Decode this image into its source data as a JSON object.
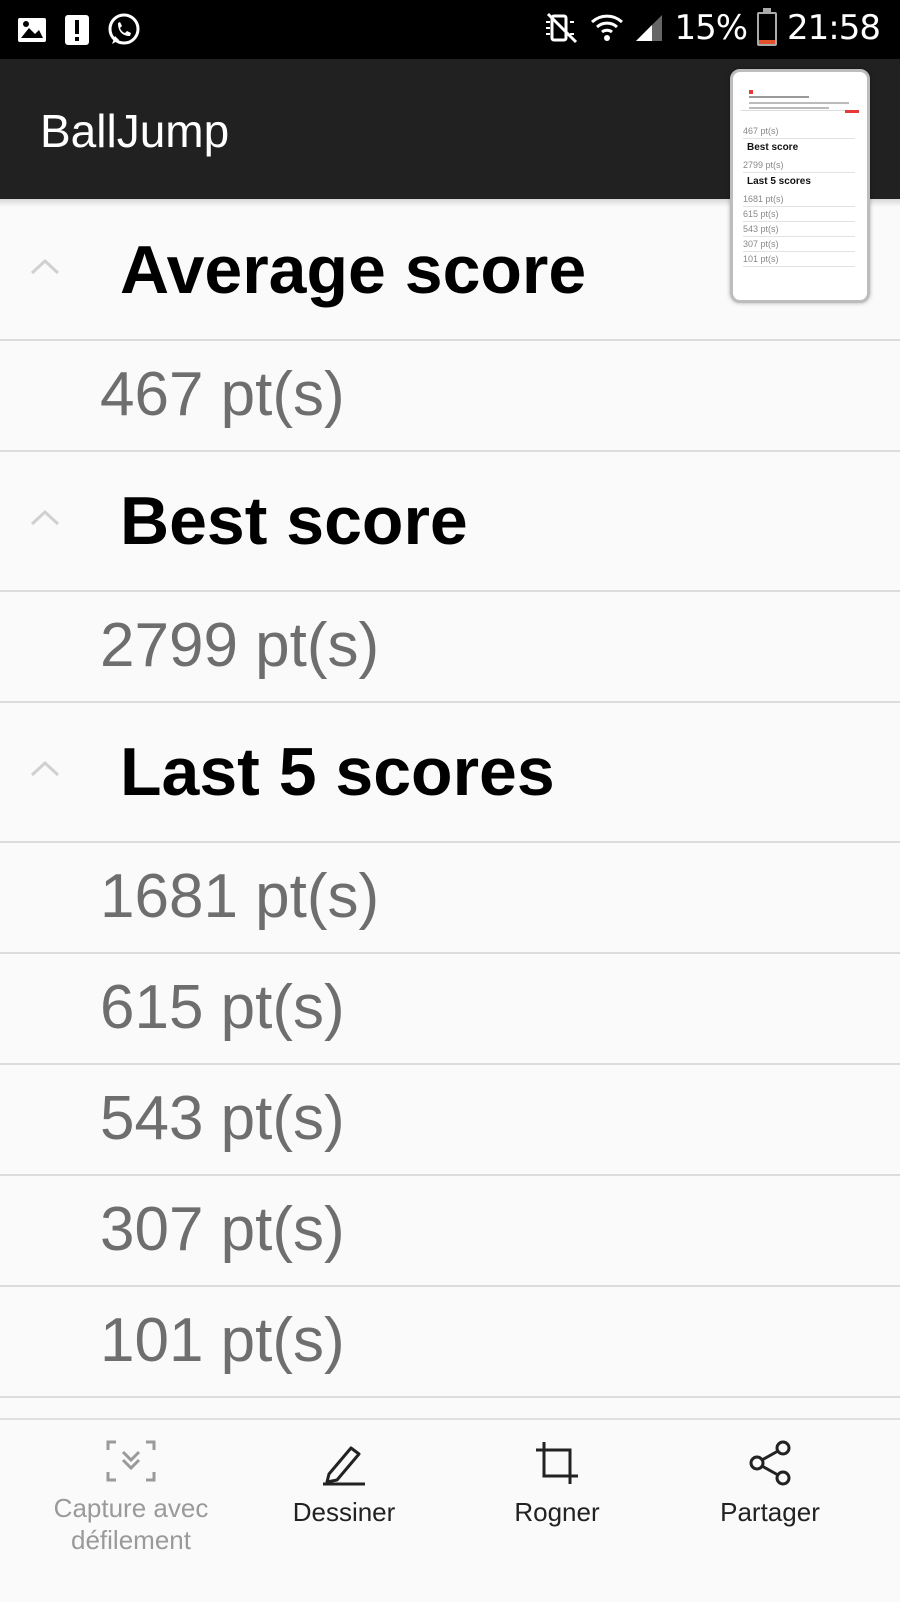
{
  "status_bar": {
    "battery": "15%",
    "time": "21:58",
    "battery_level": 0.15,
    "icons": [
      "gallery-icon",
      "alert-icon",
      "whatsapp-icon",
      "mute-icon",
      "wifi-icon",
      "signal-icon",
      "battery-icon"
    ]
  },
  "app_bar": {
    "title": "BallJump"
  },
  "sections": [
    {
      "title": "Average score",
      "scores": [
        "467 pt(s)"
      ]
    },
    {
      "title": "Best score",
      "scores": [
        "2799 pt(s)"
      ]
    },
    {
      "title": "Last 5 scores",
      "scores": [
        "1681 pt(s)",
        "615 pt(s)",
        "543 pt(s)",
        "307 pt(s)",
        "101 pt(s)"
      ]
    }
  ],
  "thumbnail": {
    "items": [
      "467 pt(s)",
      "Best score",
      "2799 pt(s)",
      "Last 5 scores",
      "1681 pt(s)",
      "615 pt(s)",
      "543 pt(s)",
      "307 pt(s)",
      "101 pt(s)"
    ]
  },
  "toolbar": {
    "scroll_capture_label": "Capture avec défilement",
    "draw_label": "Dessiner",
    "crop_label": "Rogner",
    "share_label": "Partager"
  },
  "colors": {
    "app_bar": "#212121",
    "status_bar": "#000000",
    "score_text": "#6e6e6e",
    "divider": "#dcdcdc",
    "battery_low": "#e1512b"
  }
}
